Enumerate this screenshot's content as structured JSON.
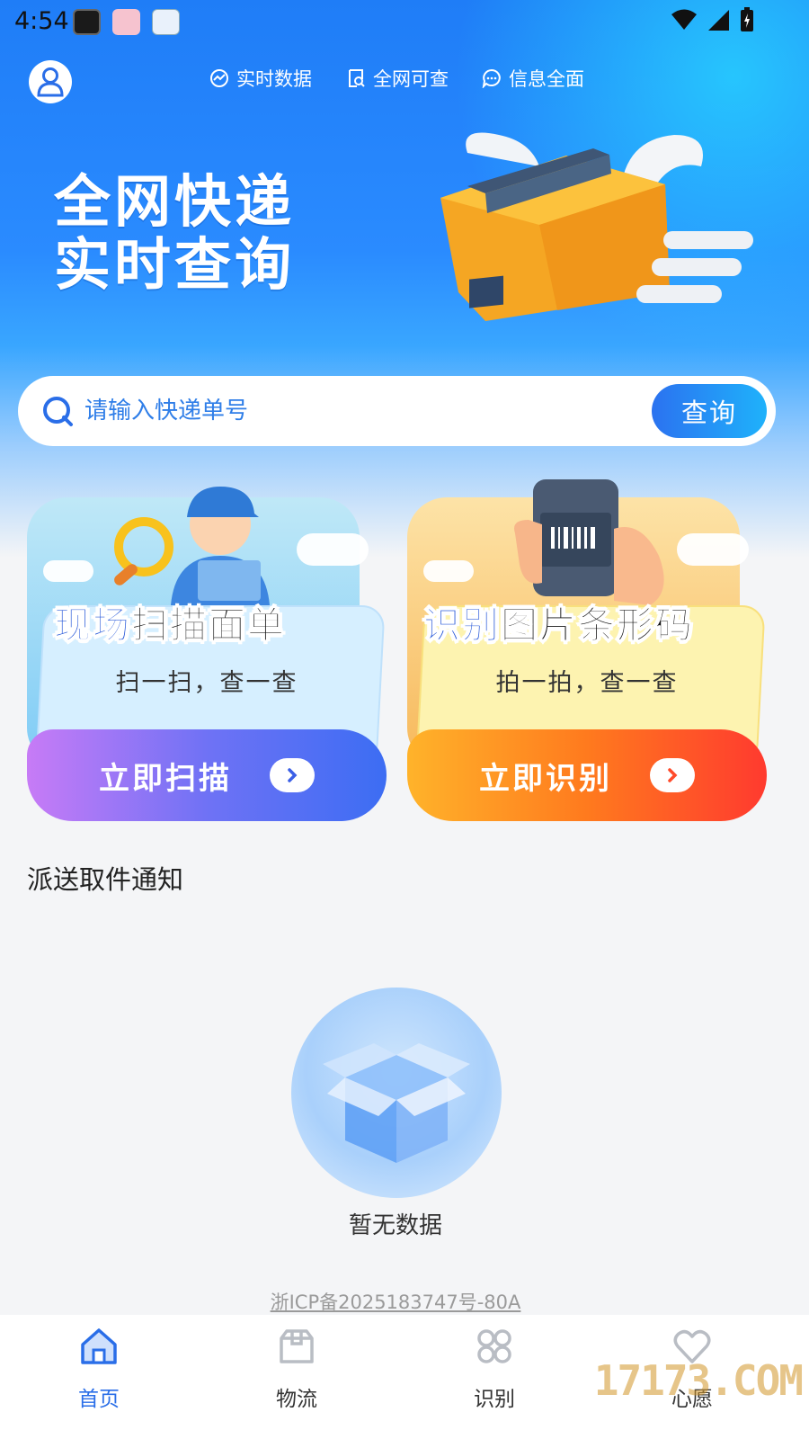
{
  "status_bar": {
    "time": "4:54"
  },
  "top_nav": {
    "features": [
      {
        "icon": "chart-trend-icon",
        "label": "实时数据"
      },
      {
        "icon": "search-doc-icon",
        "label": "全网可查"
      },
      {
        "icon": "chat-bubble-icon",
        "label": "信息全面"
      }
    ]
  },
  "banner": {
    "line1": "全网快递",
    "line2": "实时查询"
  },
  "search": {
    "placeholder": "请输入快递单号",
    "button_label": "查询"
  },
  "cards": [
    {
      "heading_highlight": "现场",
      "heading_rest": "扫描面单",
      "subtitle": "扫一扫，查一查",
      "action_label": "立即扫描"
    },
    {
      "heading_highlight": "识别",
      "heading_rest": "图片条形码",
      "subtitle": "拍一拍，查一查",
      "action_label": "立即识别"
    }
  ],
  "notices": {
    "title": "派送取件通知",
    "empty_text": "暂无数据"
  },
  "footer": {
    "icp": "浙ICP备2025183747号-80A"
  },
  "tabbar": [
    {
      "icon": "home-icon",
      "label": "首页",
      "active": true
    },
    {
      "icon": "package-icon",
      "label": "物流",
      "active": false
    },
    {
      "icon": "clover-icon",
      "label": "识别",
      "active": false
    },
    {
      "icon": "heart-icon",
      "label": "心愿",
      "active": false
    }
  ],
  "watermark": "17173.COM",
  "colors": {
    "primary": "#2a6ee8",
    "scan_card": "#6f72f5",
    "identify_card": "#ff7a1e"
  }
}
